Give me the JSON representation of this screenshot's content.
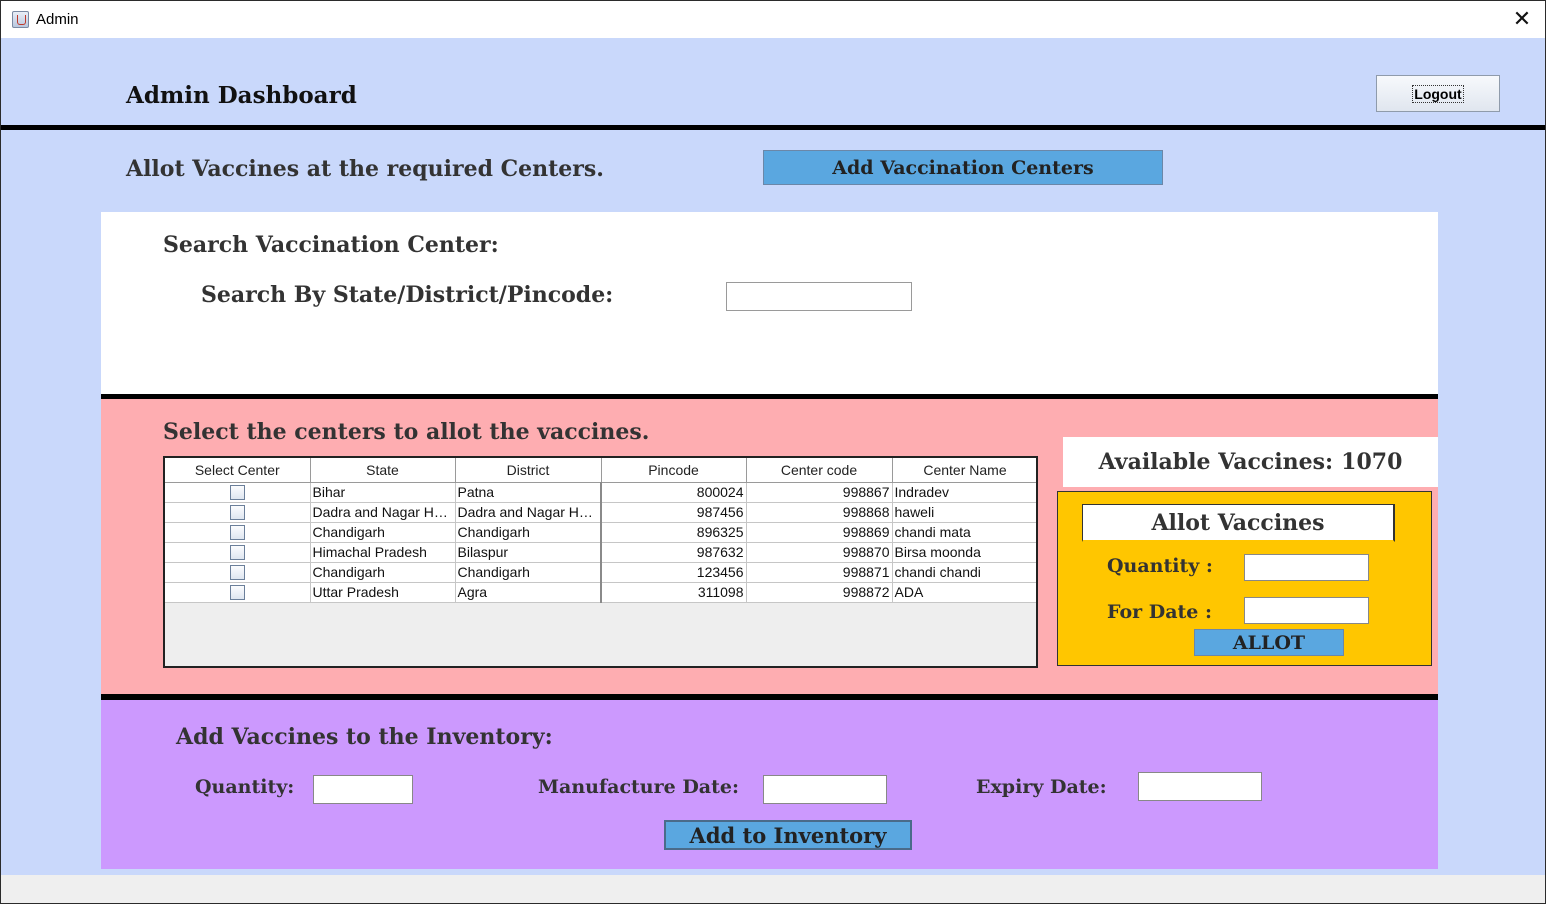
{
  "window": {
    "title": "Admin",
    "close_glyph": "✕",
    "app_icon": "java-cup-icon"
  },
  "header": {
    "title": "Admin Dashboard",
    "logout_label": "Logout"
  },
  "top": {
    "message": "Allot Vaccines at the required Centers.",
    "add_centers_label": "Add Vaccination Centers"
  },
  "search": {
    "title": "Search Vaccination Center:",
    "label": "Search By State/District/Pincode:",
    "value": ""
  },
  "centers": {
    "title": "Select the centers to allot the vaccines.",
    "columns": [
      "Select Center",
      "State",
      "District",
      "Pincode",
      "Center code",
      "Center Name"
    ],
    "rows": [
      {
        "checked": false,
        "state": "Bihar",
        "district": "Patna",
        "pincode": "800024",
        "code": "998867",
        "name": "Indradev"
      },
      {
        "checked": false,
        "state": "Dadra and Nagar Ha...",
        "district": "Dadra and Nagar Ha...",
        "pincode": "987456",
        "code": "998868",
        "name": "haweli"
      },
      {
        "checked": false,
        "state": "Chandigarh",
        "district": "Chandigarh",
        "pincode": "896325",
        "code": "998869",
        "name": "chandi mata"
      },
      {
        "checked": false,
        "state": "Himachal Pradesh",
        "district": "Bilaspur",
        "pincode": "987632",
        "code": "998870",
        "name": "Birsa moonda"
      },
      {
        "checked": false,
        "state": "Chandigarh",
        "district": "Chandigarh",
        "pincode": "123456",
        "code": "998871",
        "name": "chandi chandi"
      },
      {
        "checked": false,
        "state": "Uttar Pradesh",
        "district": "Agra",
        "pincode": "311098",
        "code": "998872",
        "name": "ADA"
      }
    ]
  },
  "available": {
    "label": "Available Vaccines:",
    "count": "1070"
  },
  "allot": {
    "title": "Allot Vaccines",
    "quantity_label": "Quantity :",
    "date_label": "For Date :",
    "button_label": "ALLOT",
    "quantity_value": "",
    "date_value": ""
  },
  "inventory": {
    "title": "Add Vaccines to the Inventory:",
    "quantity_label": "Quantity:",
    "manufacture_label": "Manufacture Date:",
    "expiry_label": "Expiry Date:",
    "button_label": "Add to Inventory",
    "quantity_value": "",
    "manufacture_value": "",
    "expiry_value": ""
  },
  "colors": {
    "frame_bg": "#c9d8fb",
    "search_bg": "#ffffff",
    "centers_bg": "#feadb1",
    "allot_bg": "#ffc600",
    "inventory_bg": "#cc99fe",
    "button_blue": "#5aa7e0"
  }
}
